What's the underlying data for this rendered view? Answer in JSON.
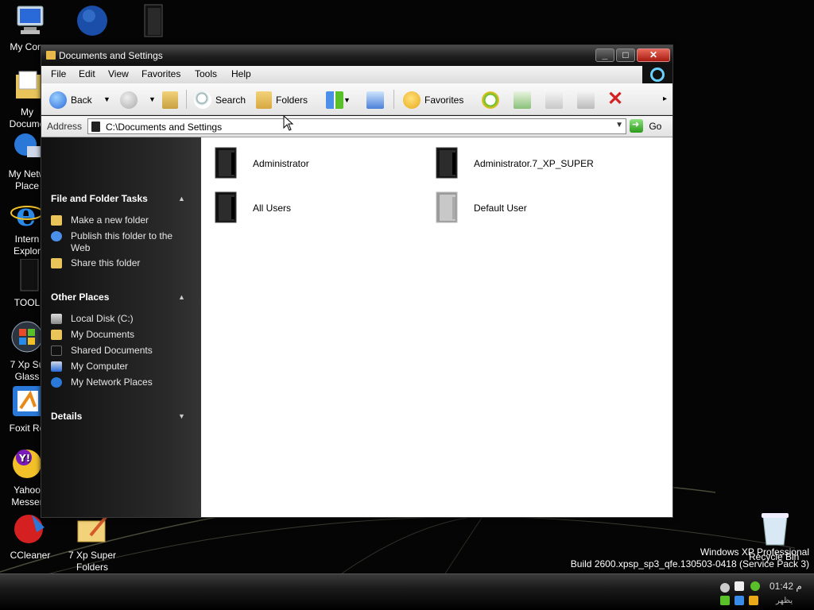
{
  "desktop": {
    "icons": [
      {
        "label": "My Comp"
      },
      {
        "label": "My\nDocume"
      },
      {
        "label": "My Netw\nPlace"
      },
      {
        "label": "Intern\nExplor"
      },
      {
        "label": "TOOL"
      },
      {
        "label": "7 Xp Su\nGlass"
      },
      {
        "label": "Foxit Re"
      },
      {
        "label": "Yahoo\nMesser"
      },
      {
        "label": "CCleaner"
      },
      {
        "label": "7 Xp Super\nFolders"
      }
    ],
    "recycle_bin_label": "Recycle Bin",
    "build_line1": "Windows XP Professional",
    "build_line2": "Build 2600.xpsp_sp3_qfe.130503-0418 (Service Pack 3)"
  },
  "window": {
    "title": "Documents and Settings",
    "buttons": {
      "minimize": "_",
      "maximize": "□",
      "close": "✕"
    },
    "menu": [
      "File",
      "Edit",
      "View",
      "Favorites",
      "Tools",
      "Help"
    ],
    "toolbar": {
      "back": "Back",
      "search": "Search",
      "folders": "Folders",
      "favorites": "Favorites"
    },
    "address": {
      "label": "Address",
      "value": "C:\\Documents and Settings",
      "go": "Go"
    }
  },
  "sidebar": {
    "sections": [
      {
        "title": "File and Folder Tasks",
        "items": [
          "Make a new folder",
          "Publish this folder to the Web",
          "Share this folder"
        ]
      },
      {
        "title": "Other Places",
        "items": [
          "Local Disk (C:)",
          "My Documents",
          "Shared Documents",
          "My Computer",
          "My Network Places"
        ]
      },
      {
        "title": "Details",
        "items": []
      }
    ]
  },
  "files": [
    {
      "name": "Administrator",
      "icon": "black-folder-icon"
    },
    {
      "name": "Administrator.7_XP_SUPER",
      "icon": "black-folder-icon"
    },
    {
      "name": "All Users",
      "icon": "black-folder-icon"
    },
    {
      "name": "Default User",
      "icon": "grey-folder-icon"
    }
  ],
  "taskbar": {
    "clock": "01:42 م",
    "clock_sub": "ﻳﻈﻬﺮ"
  },
  "colors": {
    "window_dark": "#1b1b1b",
    "sidepanel": "#2a2a2a",
    "accent_cyan": "#6ad0ff",
    "close_red": "#d42020"
  }
}
